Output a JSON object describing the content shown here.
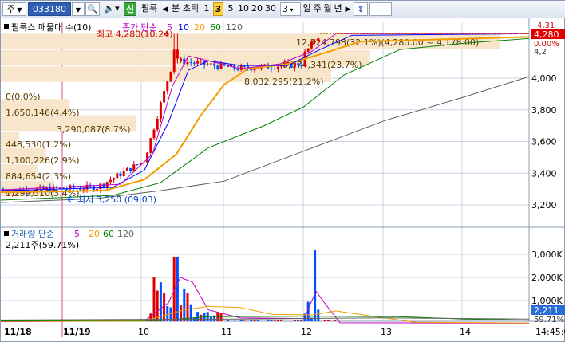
{
  "toolbar": {
    "market": "주",
    "code": "033180",
    "search_icon": "search-icon",
    "sound_icon": "speaker-icon",
    "signal_badge": "신",
    "item_toggle": "필룩",
    "prev_arrow": "◀",
    "period_minute": "분",
    "period_tick": "초틱",
    "intervals": [
      "1",
      "3",
      "5",
      "10",
      "20",
      "30"
    ],
    "selected_interval": "3",
    "count_value": "3",
    "period_day": "일",
    "period_week": "주",
    "period_month": "월",
    "period_year": "년",
    "next_arrow": "▶",
    "updown_icon": "updown-arrows-icon"
  },
  "legend": {
    "stock": "필룩스 매물대 수(10)",
    "ma_label": "종가 단순",
    "ma_periods": [
      "5",
      "10",
      "20",
      "60",
      "120"
    ],
    "ma_colors": [
      "#c000c0",
      "#0000ff",
      "#f0a000",
      "#008000",
      "#606060"
    ]
  },
  "volume_legend": {
    "label": "거래량 단순",
    "periods": [
      "5",
      "20",
      "60",
      "120"
    ],
    "value_text": "2,211주(59.71%)"
  },
  "annotations": {
    "high": "최고 4,280(10:24)",
    "low": "최저 3,250 (09:03)"
  },
  "volume_profile": [
    {
      "text": "12,124,798(32.1%)(4,280.00 ~ 4,178.00)",
      "value": 12124798,
      "pct": 32.1
    },
    {
      "text": "8,974,341(23.7%)",
      "value": 8974341,
      "pct": 23.7
    },
    {
      "text": "8,032,295(21.2%)",
      "value": 8032295,
      "pct": 21.2
    },
    {
      "text": "0(0.0%)",
      "value": 0,
      "pct": 0.0
    },
    {
      "text": "1,650,146(4.4%)",
      "value": 1650146,
      "pct": 4.4
    },
    {
      "text": "3,290,087(8.7%)",
      "value": 3290087,
      "pct": 8.7
    },
    {
      "text": "448,530(1.2%)",
      "value": 448530,
      "pct": 1.2
    },
    {
      "text": "1,100,226(2.9%)",
      "value": 1100226,
      "pct": 2.9
    },
    {
      "text": "884,654(2.3%)",
      "value": 884654,
      "pct": 2.3
    },
    {
      "text": "1,299,510(3.4%)",
      "value": 1299510,
      "pct": 3.4
    }
  ],
  "price_axis": {
    "ticks": [
      "4,000",
      "3,800",
      "3,600",
      "3,400",
      "3,200"
    ],
    "current_price": "4,280",
    "current_change": "0.00%",
    "top_partial": "4,31",
    "near_partial": "4,2"
  },
  "volume_axis": {
    "ticks": [
      "3,000K",
      "2,000K",
      "1,000K"
    ],
    "current_volume": "2,211",
    "current_pct": "59.71%"
  },
  "time_axis": {
    "labels": [
      "11/18",
      "11/19",
      "10",
      "11",
      "12",
      "13",
      "14"
    ],
    "clock": "14:45:0"
  },
  "colors": {
    "up": "#e00000",
    "down": "#0050ff",
    "profile_fill": "#f7e6cc",
    "profile_text": "#5a3b00",
    "grid": "#c8d3e6",
    "current_badge": "#e00000",
    "volume_badge": "#2a6cd6"
  }
}
